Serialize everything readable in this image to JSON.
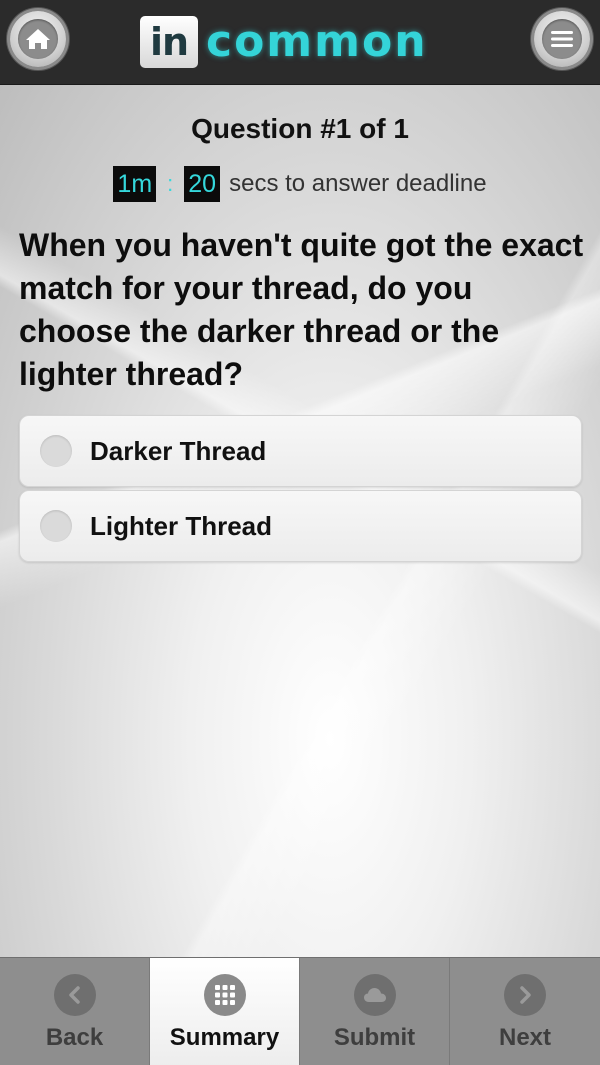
{
  "header": {
    "logo_in": "in",
    "logo_common": "common",
    "home_icon": "home-icon",
    "menu_icon": "menu-icon"
  },
  "quiz": {
    "counter": "Question #1 of 1",
    "timer": {
      "minutes": "1m",
      "separator": ":",
      "seconds": "20",
      "suffix": "secs to answer deadline"
    },
    "question": "When you haven't quite got the exact match for your thread, do you choose the darker thread or the lighter thread?",
    "options": [
      {
        "label": "Darker Thread",
        "selected": false
      },
      {
        "label": "Lighter Thread",
        "selected": false
      }
    ]
  },
  "nav": {
    "items": [
      {
        "label": "Back",
        "icon": "chevron-left-icon",
        "active": false
      },
      {
        "label": "Summary",
        "icon": "grid-icon",
        "active": true
      },
      {
        "label": "Submit",
        "icon": "cloud-icon",
        "active": false
      },
      {
        "label": "Next",
        "icon": "chevron-right-icon",
        "active": false
      }
    ]
  },
  "colors": {
    "accent": "#35d8dc",
    "header_bg": "#2b2b2b",
    "nav_bg": "#8e8e8e"
  }
}
